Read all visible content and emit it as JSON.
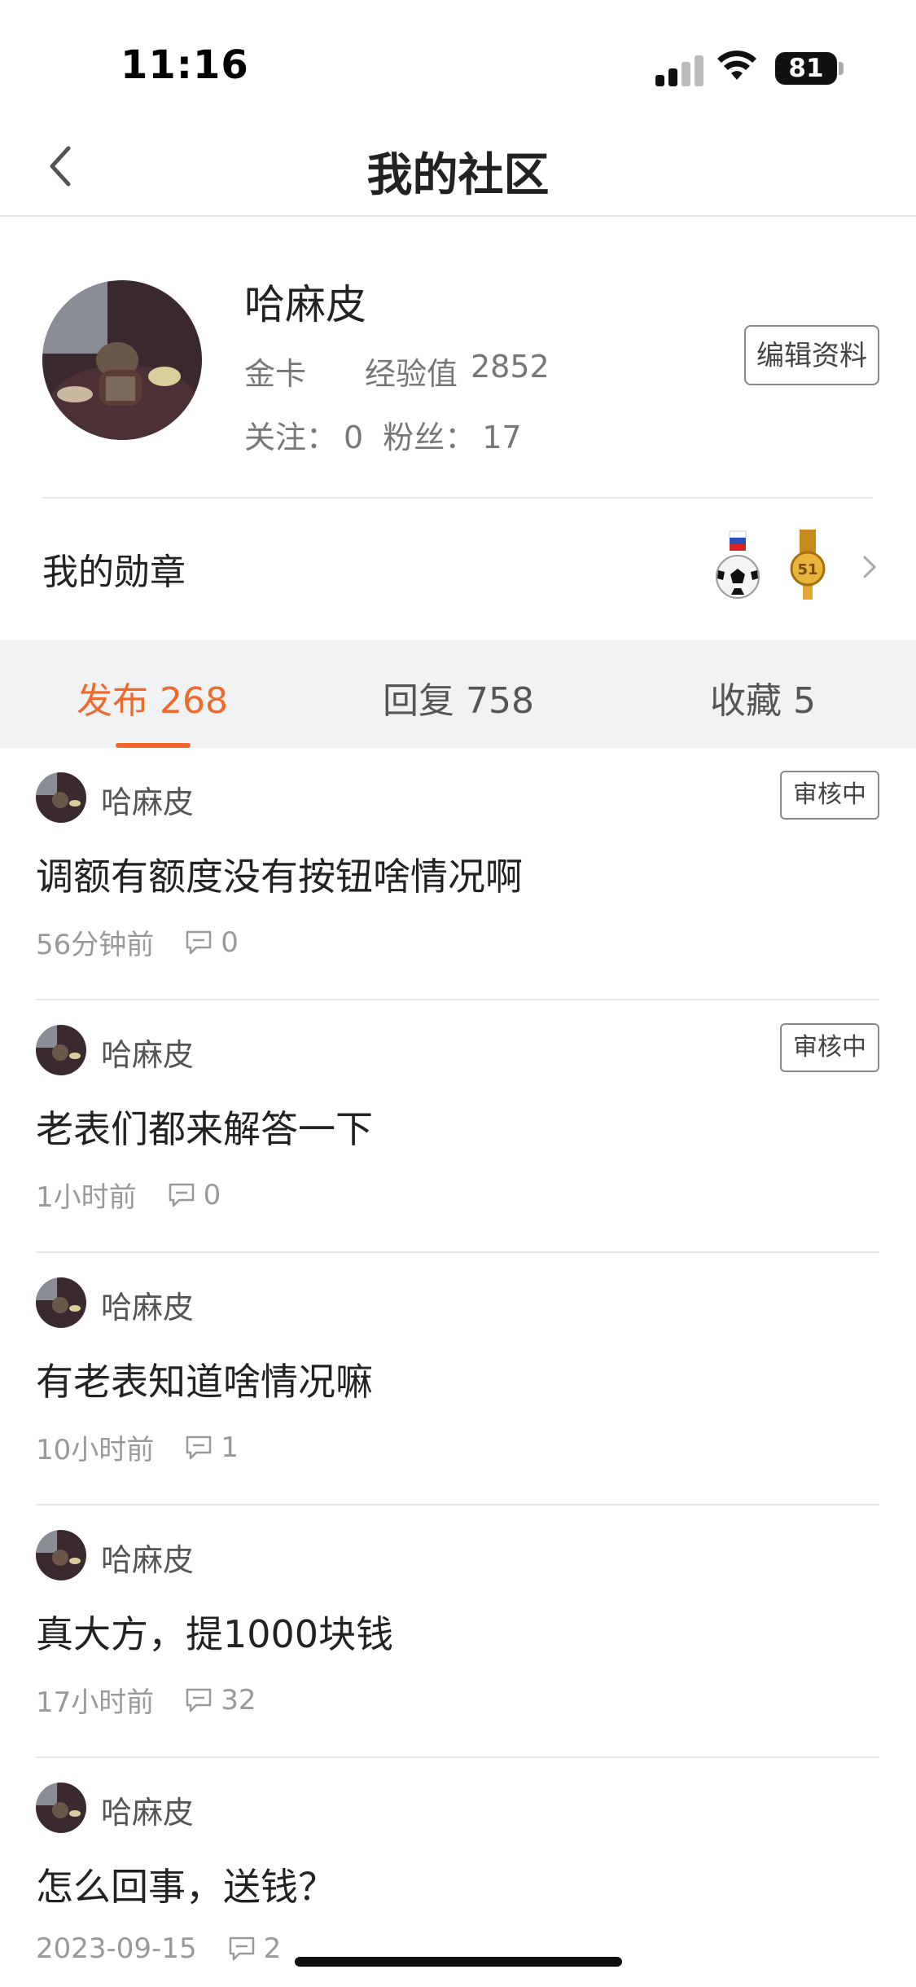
{
  "status_bar": {
    "time": "11:16",
    "battery": "81"
  },
  "nav": {
    "title": "我的社区",
    "back_icon": "chevron-left-icon"
  },
  "profile": {
    "username": "哈麻皮",
    "level": "金卡",
    "exp_label": "经验值",
    "exp_value": "2852",
    "following_label": "关注：",
    "following_count": "0",
    "followers_label": "粉丝：",
    "followers_count": "17",
    "edit_label": "编辑资料",
    "medals_label": "我的勋章",
    "medals": [
      "soccer-medal-icon",
      "gold-51-medal-icon"
    ]
  },
  "tabs": [
    {
      "label": "发布 268",
      "active": true
    },
    {
      "label": "回复 758",
      "active": false
    },
    {
      "label": "收藏 5",
      "active": false
    }
  ],
  "posts": [
    {
      "author": "哈麻皮",
      "badge": "审核中",
      "title": "调额有额度没有按钮啥情况啊",
      "time": "56分钟前",
      "comments": "0"
    },
    {
      "author": "哈麻皮",
      "badge": "审核中",
      "title": "老表们都来解答一下",
      "time": "1小时前",
      "comments": "0"
    },
    {
      "author": "哈麻皮",
      "title": "有老表知道啥情况嘛",
      "time": "10小时前",
      "comments": "1"
    },
    {
      "author": "哈麻皮",
      "title": "真大方，提1000块钱",
      "time": "17小时前",
      "comments": "32"
    },
    {
      "author": "哈麻皮",
      "title": "怎么回事，送钱？",
      "time": "2023-09-15",
      "comments": "2"
    }
  ],
  "colors": {
    "accent": "#f0692a"
  }
}
